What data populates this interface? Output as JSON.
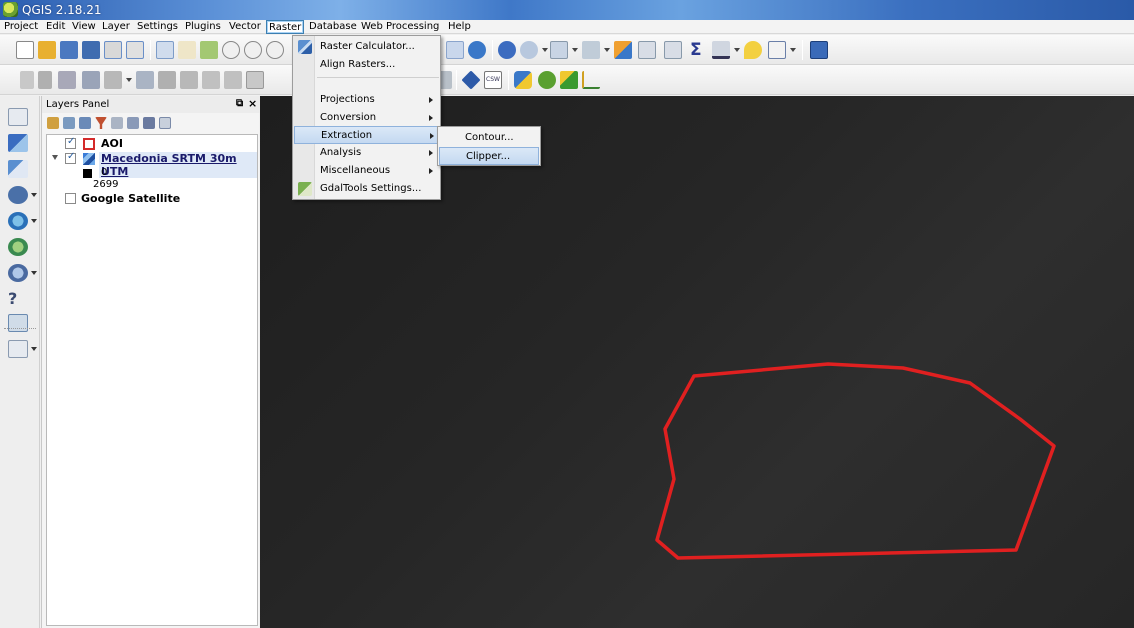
{
  "window": {
    "title": "QGIS 2.18.21"
  },
  "menubar": {
    "items": [
      "Project",
      "Edit",
      "View",
      "Layer",
      "Settings",
      "Plugins",
      "Vector",
      "Raster",
      "Database",
      "Web",
      "Processing",
      "Help"
    ],
    "active": "Raster"
  },
  "toolbar": {
    "row1_icons": [
      "new-project-icon",
      "open-project-icon",
      "save-project-icon",
      "save-as-icon",
      "new-print-composer-icon",
      "composer-manager-icon",
      "touch-zoom-icon",
      "pan-icon",
      "pan-to-selection-icon",
      "zoom-in-icon",
      "zoom-out-icon",
      "zoom-full-icon",
      "refresh-icon",
      "identify-icon",
      "select-icon",
      "measure-icon",
      "highlight-icon",
      "attribute-table-icon",
      "statistics-icon",
      "sum-icon",
      "tips-icon",
      "text-annotation-icon",
      "help-icon"
    ],
    "row2_icons": [
      "current-edits-icon",
      "toggle-editing-icon",
      "save-edits-icon",
      "add-feature-icon",
      "move-feature-icon",
      "node-tool-icon",
      "delete-selected-icon",
      "cut-features-icon",
      "copy-features-icon",
      "paste-features-icon",
      "csw-icon",
      "python-icon",
      "plugin-icon",
      "georeferencer-icon"
    ],
    "csw_label": "CSW"
  },
  "left_toolbar": {
    "icons": [
      "add-vector-layer-icon",
      "add-raster-layer-icon",
      "add-spatialite-layer-icon",
      "add-postgis-layer-icon",
      "add-wms-layer-icon",
      "add-wcs-layer-icon",
      "add-wfs-layer-icon",
      "add-delimited-text-icon",
      "add-virtual-layer-icon",
      "new-shapefile-layer-icon"
    ]
  },
  "layers_panel": {
    "title": "Layers Panel",
    "float_icon": "float-icon",
    "close_icon": "close-icon",
    "layers": [
      {
        "name": "AOI",
        "checked": true,
        "symbol": "red-outline"
      },
      {
        "name": "Macedonia SRTM 30m UTM",
        "checked": true,
        "symbol": "raster",
        "expanded": true,
        "selected": true,
        "legend": {
          "min": "0",
          "max": "2699"
        }
      },
      {
        "name": "Google Satellite",
        "checked": false,
        "symbol": "none"
      }
    ]
  },
  "raster_menu": {
    "items": [
      {
        "label": "Raster Calculator...",
        "icon": "raster-calculator-icon"
      },
      {
        "label": "Align Rasters...",
        "icon": ""
      },
      {
        "label": "Projections",
        "submenu": true
      },
      {
        "label": "Conversion",
        "submenu": true
      },
      {
        "label": "Extraction",
        "submenu": true,
        "highlighted": true
      },
      {
        "label": "Analysis",
        "submenu": true
      },
      {
        "label": "Miscellaneous",
        "submenu": true
      },
      {
        "label": "GdalTools Settings...",
        "icon": "gdaltools-settings-icon"
      }
    ],
    "extraction_submenu": [
      {
        "label": "Contour..."
      },
      {
        "label": "Clipper...",
        "highlighted": true
      }
    ]
  },
  "map": {
    "background": "#262626",
    "aoi_stroke_color": "#e02020"
  }
}
